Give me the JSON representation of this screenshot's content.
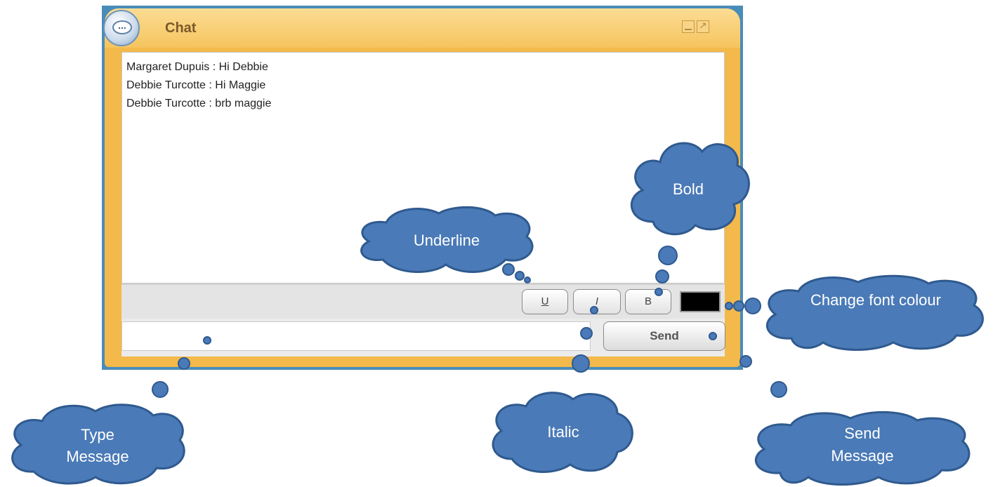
{
  "window": {
    "title": "Chat",
    "messages": [
      "Margaret Dupuis : Hi Debbie",
      "Debbie Turcotte : Hi Maggie",
      "Debbie Turcotte : brb maggie"
    ],
    "buttons": {
      "underline": "U",
      "italic": "I",
      "bold": "B",
      "send": "Send"
    },
    "font_color": "#000000",
    "accent_color": "#f3b94a",
    "border_color": "#4a8cb8"
  },
  "callouts": {
    "bold": "Bold",
    "underline": "Underline",
    "change_color": "Change font colour",
    "type_message_line1": "Type",
    "type_message_line2": "Message",
    "italic": "Italic",
    "send_message_line1": "Send",
    "send_message_line2": "Message"
  },
  "callout_color": "#4a7ab7"
}
